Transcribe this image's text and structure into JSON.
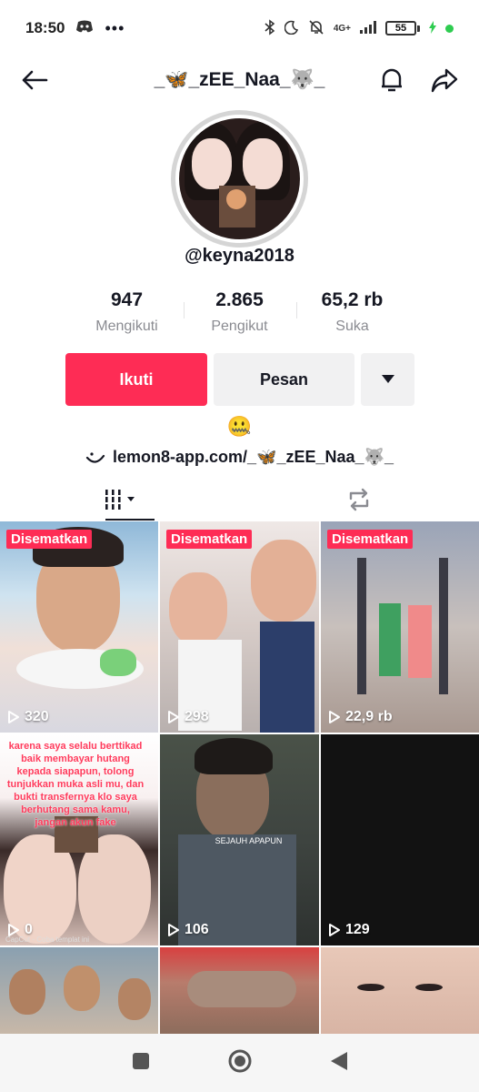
{
  "status_bar": {
    "time": "18:50",
    "battery": "55",
    "network": "4G+"
  },
  "header": {
    "title": "_🦋_zEE_Naa_🐺_"
  },
  "profile": {
    "username": "@keyna2018",
    "stats": [
      {
        "value": "947",
        "label": "Mengikuti"
      },
      {
        "value": "2.865",
        "label": "Pengikut"
      },
      {
        "value": "65,2 rb",
        "label": "Suka"
      }
    ],
    "buttons": {
      "follow": "Ikuti",
      "message": "Pesan"
    },
    "bio_emoji": "🤐",
    "link": "lemon8-app.com/_🦋_zEE_Naa_🐺_"
  },
  "grid": {
    "pinned_label": "Disematkan",
    "items": [
      {
        "views": "320"
      },
      {
        "views": "298"
      },
      {
        "views": "22,9 rb"
      },
      {
        "views": "0",
        "overlay": "karena saya selalu berttikad baik membayar hutang kepada siapapun, tolong tunjukkan muka asli mu, dan bukti transfernya klo saya berhutang sama kamu, jangan akun fake",
        "watermark": "CapCut - Coba templat ini"
      },
      {
        "views": "106",
        "caption": "SEJAUH APAPUN"
      },
      {
        "views": "129"
      }
    ]
  },
  "colors": {
    "accent": "#fe2c55",
    "secondary_button": "#f1f1f2"
  }
}
